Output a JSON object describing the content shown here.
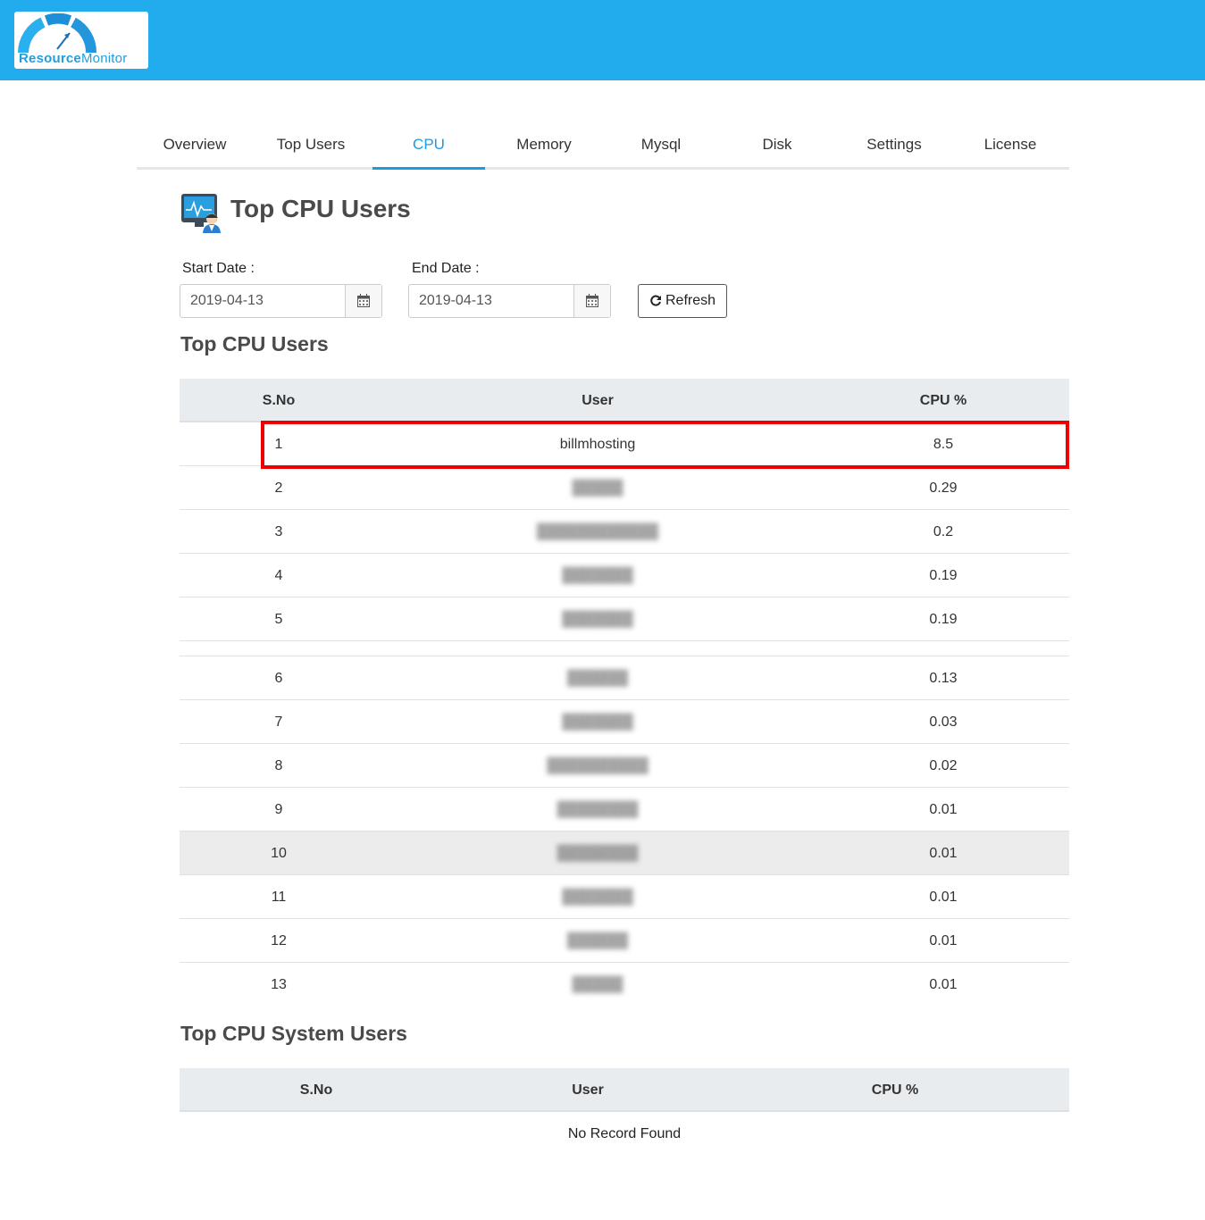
{
  "brand": {
    "name_part1": "Resource",
    "name_part2": "Monitor"
  },
  "tabs": [
    "Overview",
    "Top Users",
    "CPU",
    "Memory",
    "Mysql",
    "Disk",
    "Settings",
    "License"
  ],
  "active_tab": "CPU",
  "page": {
    "title": "Top CPU Users"
  },
  "filters": {
    "start_label": "Start Date :",
    "start_value": "2019-04-13",
    "end_label": "End Date :",
    "end_value": "2019-04-13",
    "refresh_label": "Refresh"
  },
  "cpu_users": {
    "title": "Top CPU Users",
    "headers": {
      "sno": "S.No",
      "user": "User",
      "cpu": "CPU %"
    },
    "rows": [
      {
        "sno": "1",
        "user": "billmhosting",
        "cpu": "8.5"
      },
      {
        "sno": "2",
        "user": "",
        "cpu": "0.29"
      },
      {
        "sno": "3",
        "user": "",
        "cpu": "0.2"
      },
      {
        "sno": "4",
        "user": "",
        "cpu": "0.19"
      },
      {
        "sno": "5",
        "user": "",
        "cpu": "0.19"
      },
      {
        "sno": "6",
        "user": "",
        "cpu": "0.13"
      },
      {
        "sno": "7",
        "user": "",
        "cpu": "0.03"
      },
      {
        "sno": "8",
        "user": "",
        "cpu": "0.02"
      },
      {
        "sno": "9",
        "user": "",
        "cpu": "0.01"
      },
      {
        "sno": "10",
        "user": "",
        "cpu": "0.01"
      },
      {
        "sno": "11",
        "user": "",
        "cpu": "0.01"
      },
      {
        "sno": "12",
        "user": "",
        "cpu": "0.01"
      },
      {
        "sno": "13",
        "user": "",
        "cpu": "0.01"
      }
    ]
  },
  "system_users": {
    "title": "Top CPU System Users",
    "headers": {
      "sno": "S.No",
      "user": "User",
      "cpu": "CPU %"
    },
    "empty_message": "No Record Found"
  },
  "colors": {
    "header_bar": "#22aced",
    "accent": "#1e9be0",
    "highlight": "#ee0000"
  },
  "icons": {
    "calendar": "calendar-icon",
    "refresh": "refresh-icon",
    "title": "monitor-users-icon"
  }
}
